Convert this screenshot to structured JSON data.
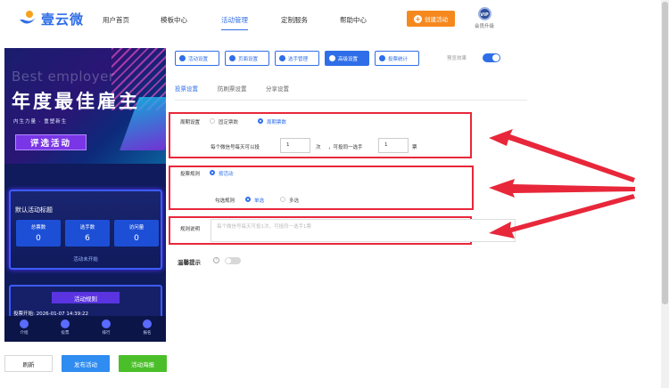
{
  "brand": {
    "name": "壹云微"
  },
  "nav": {
    "items": [
      {
        "label": "用户首页",
        "active": false
      },
      {
        "label": "模板中心",
        "active": false
      },
      {
        "label": "活动管理",
        "active": true
      },
      {
        "label": "定制服务",
        "active": false
      },
      {
        "label": "帮助中心",
        "active": false
      }
    ],
    "create_button": "创建活动",
    "vip_badge": "VIP",
    "vip_label": "会员升级"
  },
  "colors": {
    "accent": "#2f6ee8",
    "orange": "#f6891e",
    "green": "#4bbf2a",
    "annotation_red": "#e8273a"
  },
  "preview": {
    "banner_en": "Best employer",
    "banner_title": "年度最佳雇主",
    "banner_sub": "内生力量 · 重塑新生",
    "banner_button": "评选活动",
    "card_title": "默认活动标题",
    "stats": [
      {
        "label": "总票数",
        "value": "0"
      },
      {
        "label": "选手数",
        "value": "6"
      },
      {
        "label": "访问量",
        "value": "0"
      }
    ],
    "card_status": "活动未开始",
    "rules_title": "活动规则",
    "rules_start": "投票开始: 2026-01-07 14:39:22",
    "tabbar": [
      "介绍",
      "投票",
      "排行",
      "报名"
    ]
  },
  "footer_buttons": {
    "refresh": "刷新",
    "publish": "发布活动",
    "poster": "活动海报"
  },
  "toolbar": {
    "buttons": [
      {
        "label": "活动设置",
        "icon": "gear-icon",
        "active": false
      },
      {
        "label": "页面设置",
        "icon": "page-icon",
        "active": false
      },
      {
        "label": "选手管理",
        "icon": "users-icon",
        "active": false
      },
      {
        "label": "高级设置",
        "icon": "sliders-icon",
        "active": true
      },
      {
        "label": "投票统计",
        "icon": "chart-icon",
        "active": false
      }
    ],
    "preview_label": "预览效果"
  },
  "subtabs": [
    {
      "label": "投票设置",
      "active": true
    },
    {
      "label": "防刷票设置",
      "active": false
    },
    {
      "label": "分享设置",
      "active": false
    }
  ],
  "form": {
    "period": {
      "label": "周期设置",
      "options": [
        {
          "label": "固定票数",
          "selected": false
        },
        {
          "label": "周期票数",
          "selected": true
        }
      ],
      "text_before": "每个微信号每天可以投",
      "votes_value": "1",
      "text_times": "次",
      "text_mid": "，可投同一选手",
      "same_value": "1",
      "text_unit": "票"
    },
    "rule": {
      "label": "投票规则",
      "option": "按活动",
      "sub_label": "勾选规则",
      "choices": [
        {
          "label": "单选",
          "selected": true
        },
        {
          "label": "多选",
          "selected": false
        }
      ]
    },
    "desc": {
      "label": "规则说明",
      "placeholder": "每个微信号每天可投1次，可投同一选手1票"
    },
    "tip": {
      "label": "温馨提示",
      "help": "?"
    }
  }
}
